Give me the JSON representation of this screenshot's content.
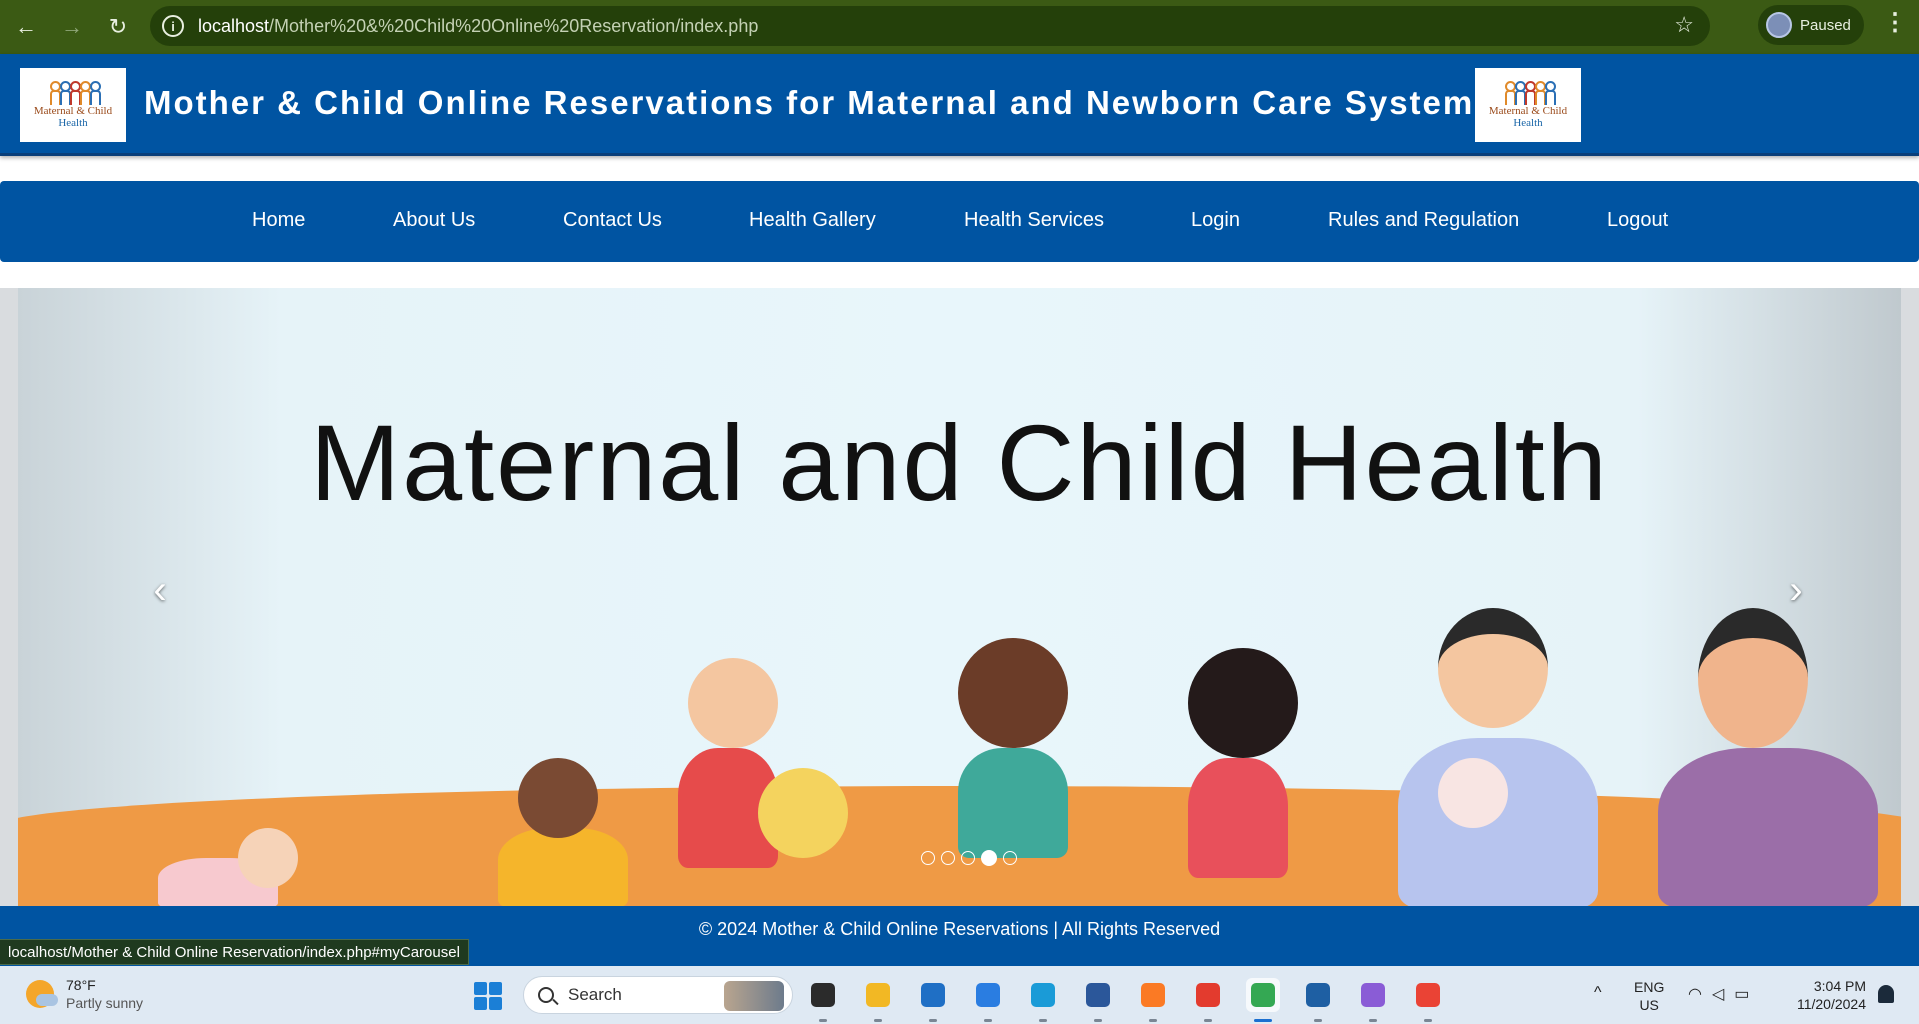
{
  "browser": {
    "back_glyph": "←",
    "forward_glyph": "→",
    "reload_glyph": "↻",
    "info_glyph": "i",
    "url_host": "localhost",
    "url_path": "/Mother%20&%20Child%20Online%20Reservation/index.php",
    "star_glyph": "☆",
    "profile_status": "Paused",
    "menu_glyph": "⋮"
  },
  "header": {
    "title": "Mother & Child Online Reservations for Maternal and Newborn Care System",
    "logo_line1": "Maternal & Child",
    "logo_line2": "Health"
  },
  "nav": {
    "items": [
      {
        "label": "Home"
      },
      {
        "label": "About Us"
      },
      {
        "label": "Contact Us"
      },
      {
        "label": "Health Gallery"
      },
      {
        "label": "Health Services"
      },
      {
        "label": "Login"
      },
      {
        "label": "Rules and Regulation"
      },
      {
        "label": "Logout"
      }
    ]
  },
  "carousel": {
    "slide_heading": "Maternal and Child Health",
    "prev_glyph": "‹",
    "next_glyph": "›",
    "slide_count": 5,
    "active_index": 3
  },
  "footer": {
    "text": "© 2024 Mother & Child Online Reservations | All Rights Reserved"
  },
  "status_bar": {
    "link": "localhost/Mother & Child Online Reservation/index.php#myCarousel"
  },
  "taskbar": {
    "weather_temp": "78°F",
    "weather_desc": "Partly sunny",
    "search_placeholder": "Search",
    "tray_caret": "^",
    "lang_line1": "ENG",
    "lang_line2": "US",
    "time": "3:04 PM",
    "date": "11/20/2024",
    "apps": [
      {
        "name": "task-view",
        "color": "#2b2b2b"
      },
      {
        "name": "file-explorer",
        "color": "#f2b824"
      },
      {
        "name": "microsoft-store",
        "color": "#1f6fc5"
      },
      {
        "name": "app-store-a",
        "color": "#2a7de1"
      },
      {
        "name": "edge",
        "color": "#1a9bd7"
      },
      {
        "name": "word",
        "color": "#2b579a"
      },
      {
        "name": "xampp",
        "color": "#fb7a24"
      },
      {
        "name": "wps-office",
        "color": "#e33b2e"
      },
      {
        "name": "chrome",
        "color": "#34a853"
      },
      {
        "name": "remote-app",
        "color": "#1e5fa3"
      },
      {
        "name": "photos-app",
        "color": "#8a5cd6"
      },
      {
        "name": "chrome-profile-k",
        "color": "#ea4335"
      }
    ]
  }
}
